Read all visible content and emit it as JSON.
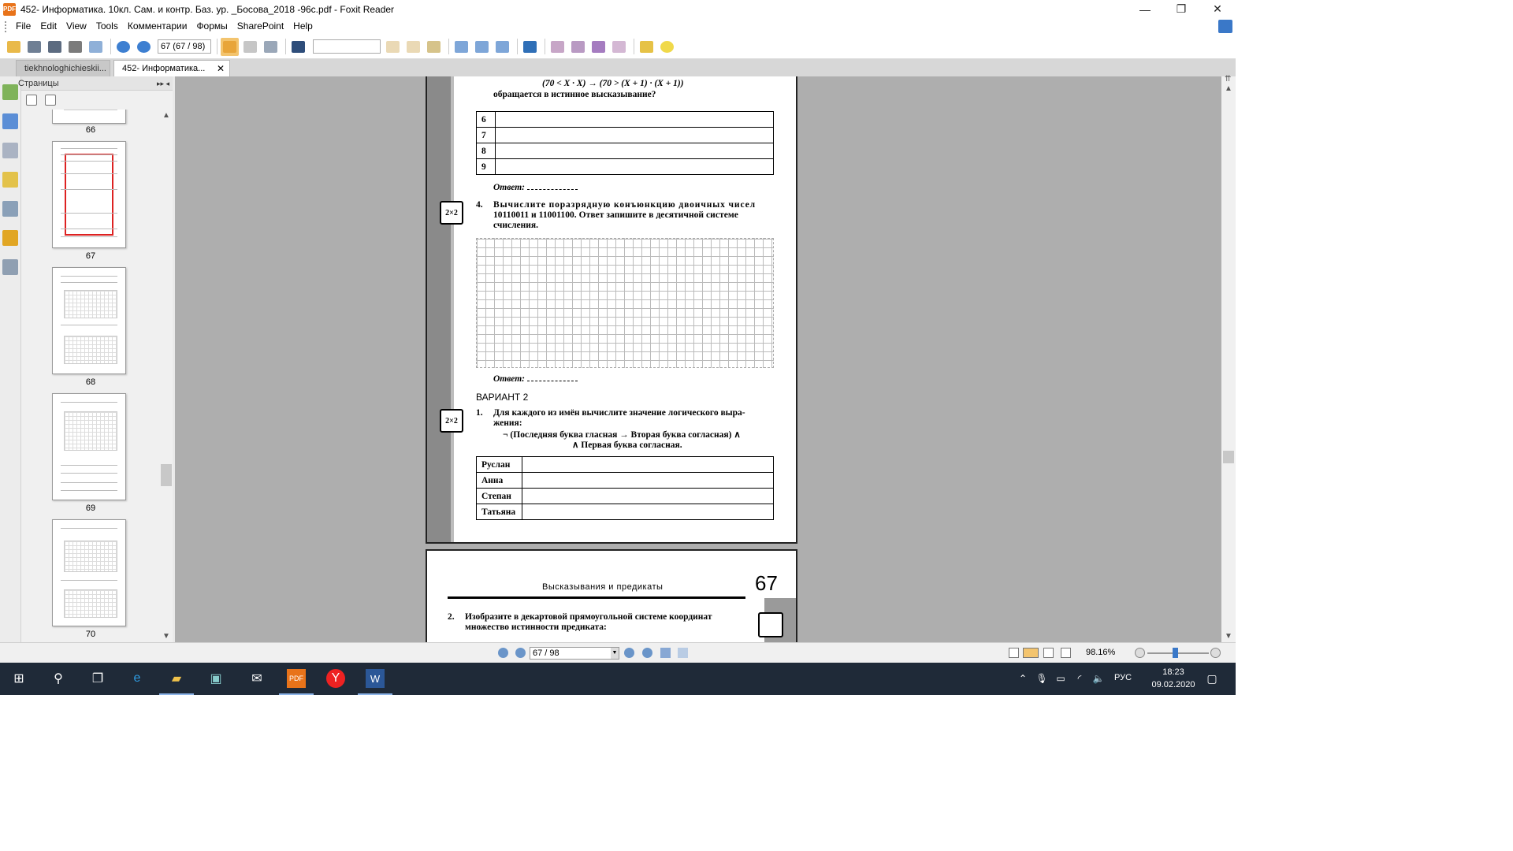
{
  "window": {
    "title": "452- Информатика. 10кл. Сам. и контр. Баз. ур. _Босова_2018 -96с.pdf - Foxit Reader",
    "minimize": "—",
    "maximize": "❐",
    "close": "✕"
  },
  "menu": [
    "File",
    "Edit",
    "View",
    "Tools",
    "Комментарии",
    "Формы",
    "SharePoint",
    "Help"
  ],
  "toolbar": {
    "page_field": "67 (67 / 98)",
    "find_value": ""
  },
  "tabs": [
    {
      "label": "tiekhnologhichieskii..."
    },
    {
      "label": "452- Информатика...",
      "close": "✕"
    }
  ],
  "panel": {
    "title": "Страницы",
    "thumbs": [
      {
        "num": "66"
      },
      {
        "num": "67"
      },
      {
        "num": "68"
      },
      {
        "num": "69"
      },
      {
        "num": "70"
      }
    ]
  },
  "doc": {
    "formula": "(70 < X · X) → (70 > (X + 1) · (X + 1))",
    "formula_tail": "обращается в истинное высказывание?",
    "table1_rows": [
      "6",
      "7",
      "8",
      "9"
    ],
    "answer_label": "Ответ:",
    "task4_num": "4.",
    "task4_line1": "Вычислите поразрядную конъюнкцию двоичных чисел",
    "task4_line2": "10110011 и 11001100. Ответ запишите в десятичной системе",
    "task4_line3": "счисления.",
    "mark_label": "2×2",
    "variant": "ВАРИАНТ 2",
    "task1_num": "1.",
    "task1_line1": "Для каждого из имён вычислите значение логического выра-",
    "task1_line2": "жения:",
    "task1_line3": "¬ (Последняя буква гласная → Вторая буква согласная) ∧",
    "task1_line4": "∧ Первая буква согласная.",
    "table2_rows": [
      "Руслан",
      "Анна",
      "Степан",
      "Татьяна"
    ],
    "page2_header": "Высказывания и предикаты",
    "page2_num": "67",
    "task2_num": "2.",
    "task2_line1": "Изобразите в декартовой прямоугольной системе координат",
    "task2_line2": "множество истинности предиката:"
  },
  "status": {
    "nav_page": "67 / 98",
    "zoom": "98.16%"
  },
  "taskbar": {
    "lang": "РУС",
    "time": "18:23",
    "date": "09.02.2020"
  },
  "colors": {
    "accent": "#3a78c8",
    "taskbar": "#1f2a38",
    "doc_bg": "#aeaeae"
  }
}
